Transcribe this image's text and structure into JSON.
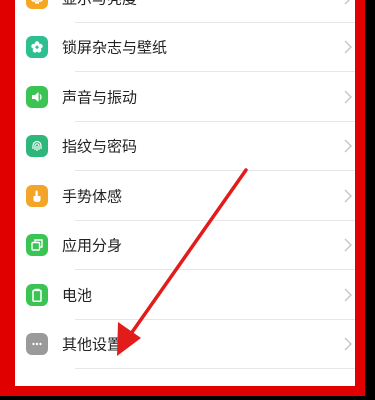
{
  "settings": {
    "items": [
      {
        "label": "显示与亮度",
        "icon": "display-brightness-icon",
        "color": "#f5a623"
      },
      {
        "label": "锁屏杂志与壁纸",
        "icon": "wallpaper-flower-icon",
        "color": "#2dbf8f"
      },
      {
        "label": "声音与振动",
        "icon": "speaker-icon",
        "color": "#3ac454"
      },
      {
        "label": "指纹与密码",
        "icon": "fingerprint-icon",
        "color": "#2db77a"
      },
      {
        "label": "手势体感",
        "icon": "hand-gesture-icon",
        "color": "#f3a52a"
      },
      {
        "label": "应用分身",
        "icon": "app-clone-icon",
        "color": "#3ac454"
      },
      {
        "label": "电池",
        "icon": "battery-icon",
        "color": "#3ac454"
      },
      {
        "label": "其他设置",
        "icon": "more-dots-icon",
        "color": "#9a9a9a"
      }
    ]
  },
  "annotation": {
    "arrow_color": "#e21b1b",
    "frame_color": "#e00000"
  }
}
